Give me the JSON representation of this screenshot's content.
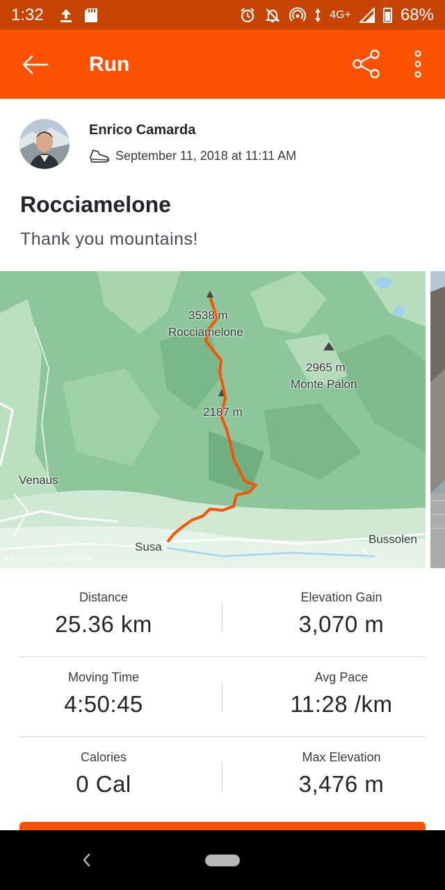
{
  "status_bar": {
    "time": "1:32",
    "network": "4G+",
    "battery": "68%"
  },
  "app_bar": {
    "title": "Run"
  },
  "athlete": {
    "name": "Enrico Camarda",
    "date": "September 11, 2018 at 11:11 AM"
  },
  "activity": {
    "title": "Rocciamelone",
    "description": "Thank you mountains!"
  },
  "map": {
    "labels": {
      "peak_elev": "3538 m",
      "peak_name": "Rocciamelone",
      "palon_elev": "2965 m",
      "palon_name": "Monte Palon",
      "mid_elev": "2187 m",
      "venaus": "Venaus",
      "susa": "Susa",
      "bussoleno": "Bussolen"
    },
    "attribution": "© Mapbox © OpenStreetMap",
    "route_color": "#fc5200"
  },
  "stats": [
    {
      "left": {
        "label": "Distance",
        "value": "25.36 km"
      },
      "right": {
        "label": "Elevation Gain",
        "value": "3,070 m"
      }
    },
    {
      "left": {
        "label": "Moving Time",
        "value": "4:50:45"
      },
      "right": {
        "label": "Avg Pace",
        "value": "11:28 /km"
      }
    },
    {
      "left": {
        "label": "Calories",
        "value": "0 Cal"
      },
      "right": {
        "label": "Max Elevation",
        "value": "3,476 m"
      }
    }
  ],
  "colors": {
    "brand": "#fc5200",
    "status_bar": "#c64300"
  }
}
